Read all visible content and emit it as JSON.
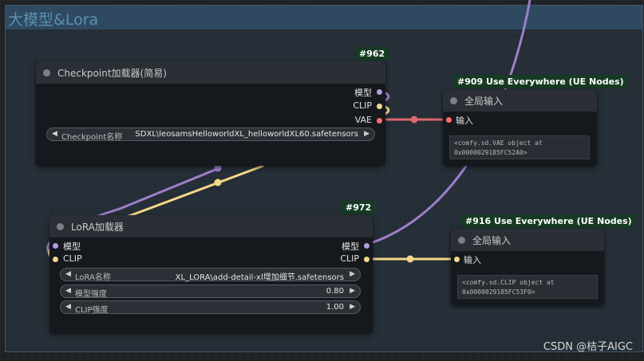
{
  "group": {
    "title": "大模型&Lora"
  },
  "checkpoint_node": {
    "id_badge": "#962",
    "title": "Checkpoint加载器(简易)",
    "outputs": {
      "model": "模型",
      "clip": "CLIP",
      "vae": "VAE"
    },
    "widget": {
      "label": "Checkpoint名称",
      "value": "SDXL\\leosamsHelloworldXL_helloworldXL60.safetensors"
    }
  },
  "vae_node": {
    "id_badge": "#909 Use Everywhere (UE Nodes)",
    "title": "全局输入",
    "input_label": "输入",
    "text_lines": [
      "<comfy.sd.VAE object at",
      "0x0000029185FC52A0>"
    ]
  },
  "lora_node": {
    "id_badge": "#972",
    "title": "LoRA加载器",
    "inputs": {
      "model": "模型",
      "clip": "CLIP"
    },
    "outputs": {
      "model": "模型",
      "clip": "CLIP"
    },
    "widgets": [
      {
        "label": "LoRA名称",
        "value": "XL_LORA\\add-detail-xl增加细节.safetensors"
      },
      {
        "label": "模型强度",
        "value": "0.80"
      },
      {
        "label": "CLIP强度",
        "value": "1.00"
      }
    ]
  },
  "clip_node": {
    "id_badge": "#916 Use Everywhere (UE Nodes)",
    "title": "全局输入",
    "input_label": "输入",
    "text_lines": [
      "<comfy.sd.CLIP object at",
      "0x0000029185FC53F0>"
    ]
  },
  "watermark": "CSDN @桔子AIGC",
  "colors": {
    "model_wire": "#9b7fc9",
    "clip_wire": "#f3d78a",
    "vae_wire": "#d9686e",
    "badge_bg": "#163a23"
  },
  "icons": {
    "arrow_left": "◀",
    "arrow_right": "▶"
  }
}
